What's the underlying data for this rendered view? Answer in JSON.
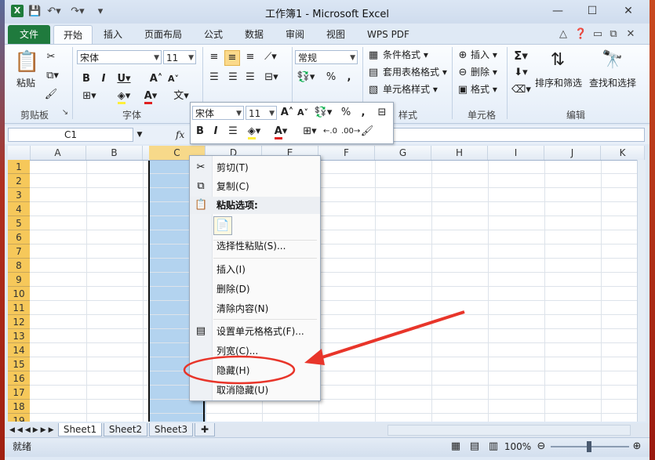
{
  "window": {
    "title": "工作簿1 - Microsoft Excel",
    "app_logo_letter": "X",
    "min_glyph": "—",
    "max_glyph": "☐",
    "close_glyph": "✕"
  },
  "tabs": {
    "file": "文件",
    "items": [
      "开始",
      "插入",
      "页面布局",
      "公式",
      "数据",
      "审阅",
      "视图",
      "WPS PDF"
    ]
  },
  "ribbon": {
    "clipboard": {
      "paste": "粘贴",
      "label": "剪贴板"
    },
    "font": {
      "name": "宋体",
      "size": "11",
      "label": "字体",
      "wen": "文"
    },
    "number": {
      "format": "常规",
      "percent": "%",
      "comma": ","
    },
    "styles": {
      "conditional": "条件格式",
      "table": "套用表格格式",
      "cell": "单元格样式",
      "label": "样式"
    },
    "cells": {
      "insert": "插入",
      "delete": "删除",
      "format": "格式",
      "label": "单元格"
    },
    "editing": {
      "sigma": "Σ",
      "sort": "排序和筛选",
      "find": "查找和选择",
      "label": "编辑"
    }
  },
  "formula_bar": {
    "name_box": "C1",
    "fx": "fx"
  },
  "grid": {
    "columns": [
      "A",
      "B",
      "C",
      "D",
      "E",
      "F",
      "G",
      "H",
      "I",
      "J",
      "K"
    ],
    "rows": [
      "1",
      "2",
      "3",
      "4",
      "5",
      "6",
      "7",
      "8",
      "9",
      "10",
      "11",
      "12",
      "13",
      "14",
      "15",
      "16",
      "17",
      "18",
      "19"
    ],
    "selected_column": "C"
  },
  "mini_toolbar": {
    "font": "宋体",
    "size": "11",
    "percent": "%",
    "comma": ","
  },
  "context_menu": {
    "cut": "剪切(T)",
    "copy": "复制(C)",
    "paste_options": "粘贴选项:",
    "paste_special": "选择性粘贴(S)...",
    "insert": "插入(I)",
    "delete": "删除(D)",
    "clear": "清除内容(N)",
    "format_cells": "设置单元格格式(F)...",
    "col_width": "列宽(C)...",
    "hide": "隐藏(H)",
    "unhide": "取消隐藏(U)"
  },
  "sheets": [
    "Sheet1",
    "Sheet2",
    "Sheet3"
  ],
  "status": {
    "ready": "就绪",
    "zoom": "100%"
  },
  "colors": {
    "file_tab": "#1f7a3d",
    "highlight_red": "#e8352a",
    "selection": "#b3d3ef",
    "row_header": "#f6c85a"
  }
}
